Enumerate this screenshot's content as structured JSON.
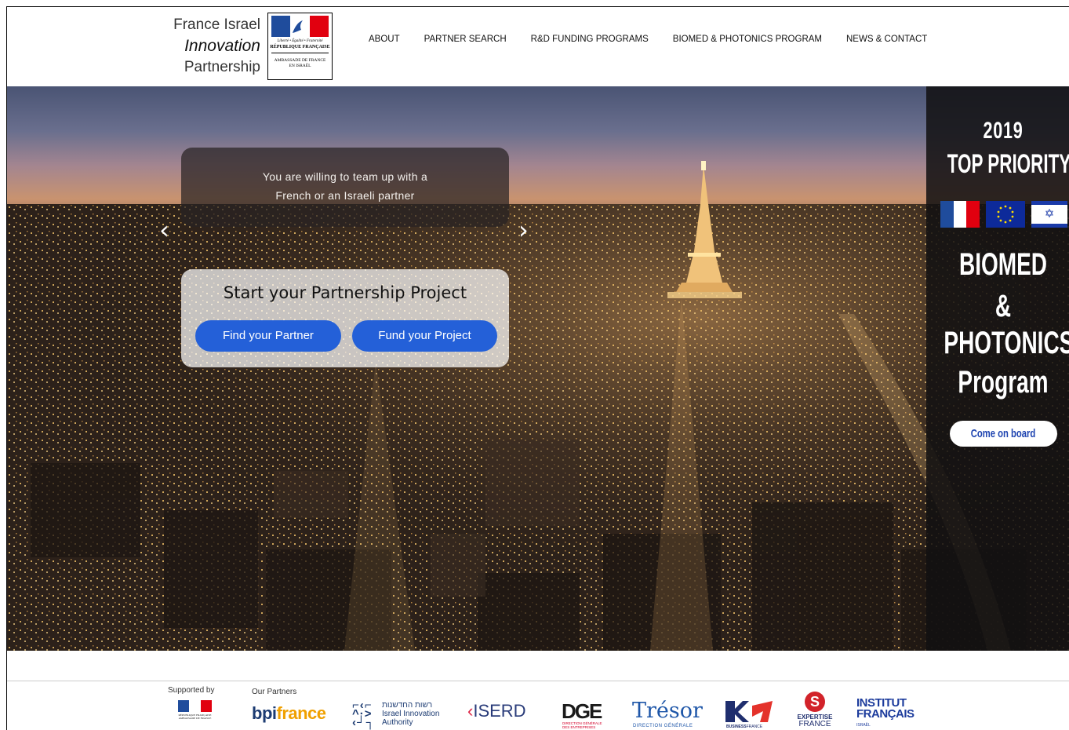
{
  "header": {
    "logo_line1": "France Israel",
    "logo_line2": "Innovation",
    "logo_line3": "Partnership",
    "seal_motto": "Liberté • Égalité • Fraternité",
    "seal_republic": "RÉPUBLIQUE FRANÇAISE",
    "seal_embassy_1": "AMBASSADE DE FRANCE",
    "seal_embassy_2": "EN ISRAËL",
    "nav": [
      {
        "label": "ABOUT"
      },
      {
        "label": "PARTNER SEARCH"
      },
      {
        "label": "R&D FUNDING PROGRAMS"
      },
      {
        "label": "BIOMED & PHOTONICS PROGRAM"
      },
      {
        "label": "NEWS & CONTACT"
      }
    ]
  },
  "hero": {
    "message_line1": "You are willing to team up with a",
    "message_line2": "French or an Israeli partner",
    "prev_arrow": "‹",
    "next_arrow": "›",
    "cta_title": "Start your Partnership Project",
    "find_partner_label": "Find your Partner",
    "fund_project_label": "Fund your Project"
  },
  "priority_panel": {
    "year": "2019",
    "heading": "TOP PRIORITY",
    "line1": "BIOMED",
    "line2": "&",
    "line3": "PHOTONICS",
    "line4": "Program",
    "button_label": "Come on board",
    "flag_il_symbol": "✡"
  },
  "footer": {
    "supported_by": "Supported by",
    "our_partners": "Our Partners",
    "partners": {
      "bpi_a": "bpi",
      "bpi_b": "france",
      "iia_line1": "רשות החדשנות",
      "iia_line2": "Israel Innovation",
      "iia_line3": "Authority",
      "isered": "ISERD",
      "dge": "DGE",
      "dge_sub1": "DIRECTION GÉNÉRALE",
      "dge_sub2": "DES ENTREPRISES",
      "tresor": "Trésor",
      "tresor_sub": "DIRECTION GÉNÉRALE",
      "bfr_a": "BUSINESS",
      "bfr_b": "FRANCE",
      "exp_1": "EXPERTISE",
      "exp_2": "FRANCE",
      "ifr_1": "INSTITUT",
      "ifr_2": "FRANÇAIS",
      "ifr_sub": "ISRAËL"
    }
  },
  "colors": {
    "accent_blue": "#2460d8",
    "panel_bg": "#121012",
    "fr_blue": "#1f4c9c",
    "fr_red": "#e1000f"
  }
}
